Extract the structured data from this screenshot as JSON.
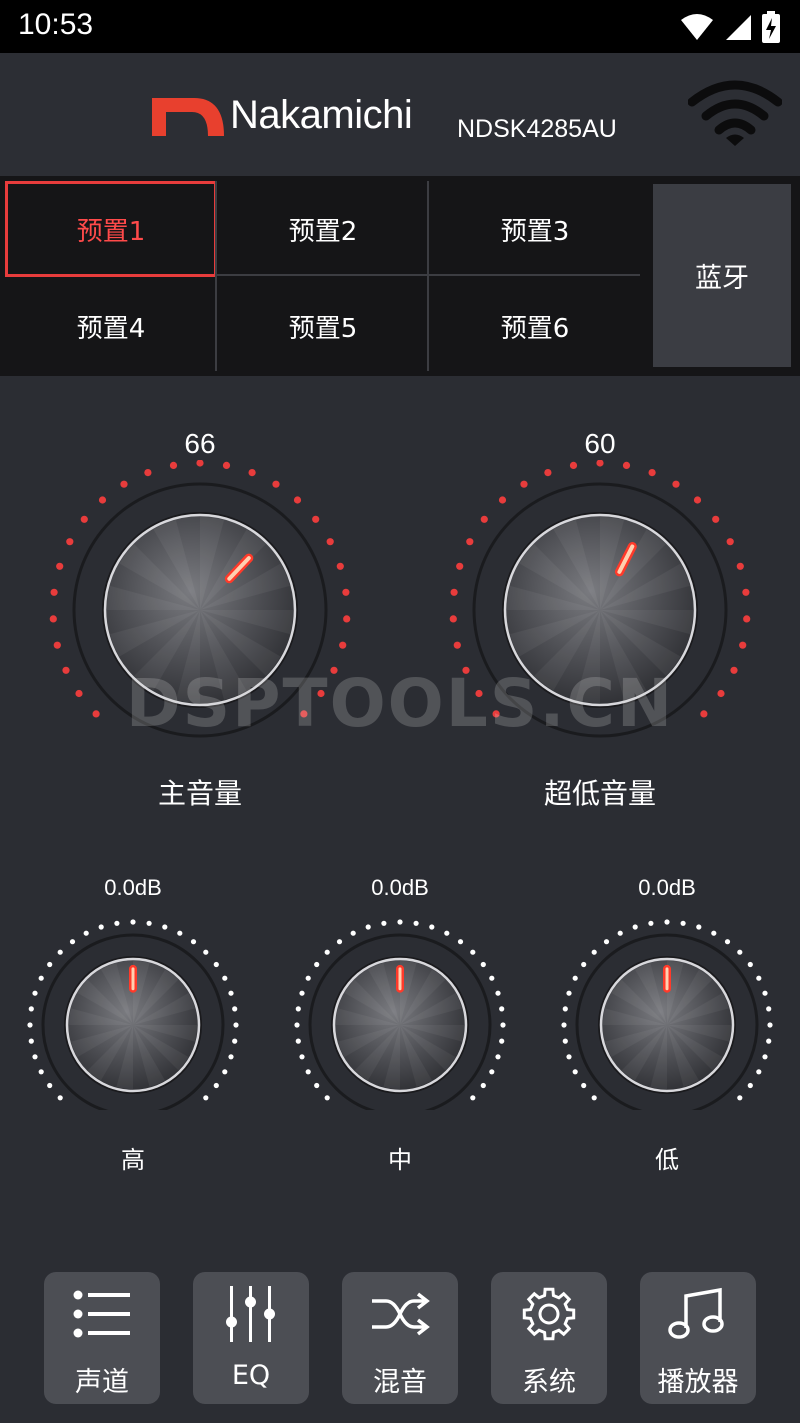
{
  "status_bar": {
    "time": "10:53"
  },
  "header": {
    "brand": "Nakamichi",
    "model": "NDSK4285AU"
  },
  "presets": [
    {
      "label": "预置1",
      "active": true
    },
    {
      "label": "预置2",
      "active": false
    },
    {
      "label": "预置3",
      "active": false
    },
    {
      "label": "预置4",
      "active": false
    },
    {
      "label": "预置5",
      "active": false
    },
    {
      "label": "预置6",
      "active": false
    }
  ],
  "bluetooth_label": "蓝牙",
  "main_volume": {
    "value": "66",
    "label": "主音量",
    "level": 66
  },
  "sub_volume": {
    "value": "60",
    "label": "超低音量",
    "level": 60
  },
  "tone": {
    "high": {
      "value": "0.0dB",
      "label": "高"
    },
    "mid": {
      "value": "0.0dB",
      "label": "中"
    },
    "low": {
      "value": "0.0dB",
      "label": "低"
    }
  },
  "watermark": "DSPTOOLS.CN",
  "nav": [
    {
      "label": "声道",
      "icon": "list-icon"
    },
    {
      "label": "EQ",
      "icon": "sliders-icon"
    },
    {
      "label": "混音",
      "icon": "shuffle-icon"
    },
    {
      "label": "系统",
      "icon": "gear-icon"
    },
    {
      "label": "播放器",
      "icon": "music-note-icon"
    }
  ],
  "colors": {
    "accent": "#e83c3c",
    "background": "#2b2d33",
    "preset_bg": "#151517",
    "button_bg": "#4c4e54"
  }
}
